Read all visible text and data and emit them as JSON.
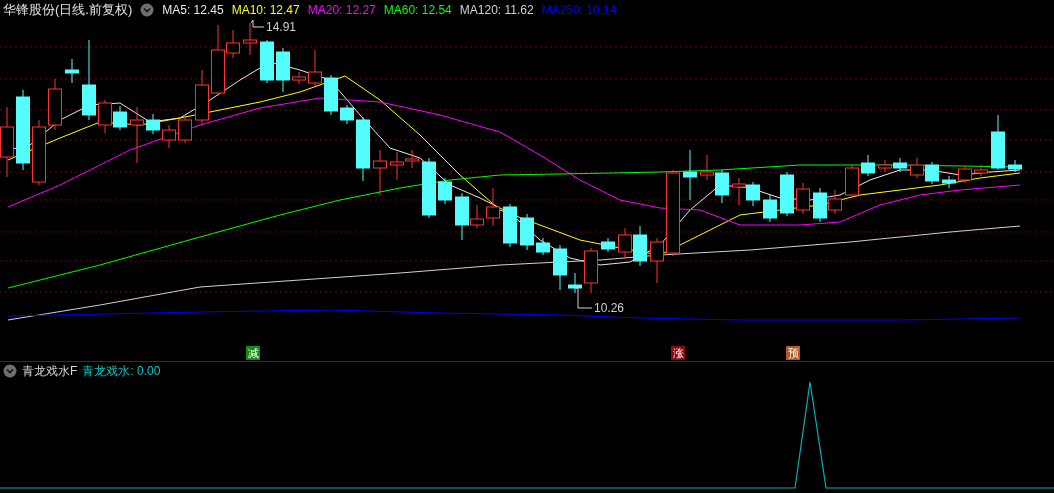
{
  "security": {
    "name": "华锋股份(日线.前复权)"
  },
  "ma_legend": [
    {
      "label": "MA5: 12.45",
      "color": "#e8e8e8"
    },
    {
      "label": "MA10: 12.47",
      "color": "#ffff00"
    },
    {
      "label": "MA20: 12.27",
      "color": "#ff00ff"
    },
    {
      "label": "MA60: 12.54",
      "color": "#00ff00"
    },
    {
      "label": "MA120: 11.62",
      "color": "#d0d0d0"
    },
    {
      "label": "MA250: 10.14",
      "color": "#0000ff"
    }
  ],
  "price_labels": [
    {
      "kind": "high",
      "text": "14.91"
    },
    {
      "kind": "low",
      "text": "10.26"
    }
  ],
  "signals": [
    {
      "text": "减",
      "color": "#158a15"
    },
    {
      "text": "涨",
      "color": "#8b0a0a"
    },
    {
      "text": "预",
      "color": "#b8561e"
    }
  ],
  "indicator": {
    "name": "青龙戏水F",
    "value_label": "青龙戏水: 0.00"
  }
}
